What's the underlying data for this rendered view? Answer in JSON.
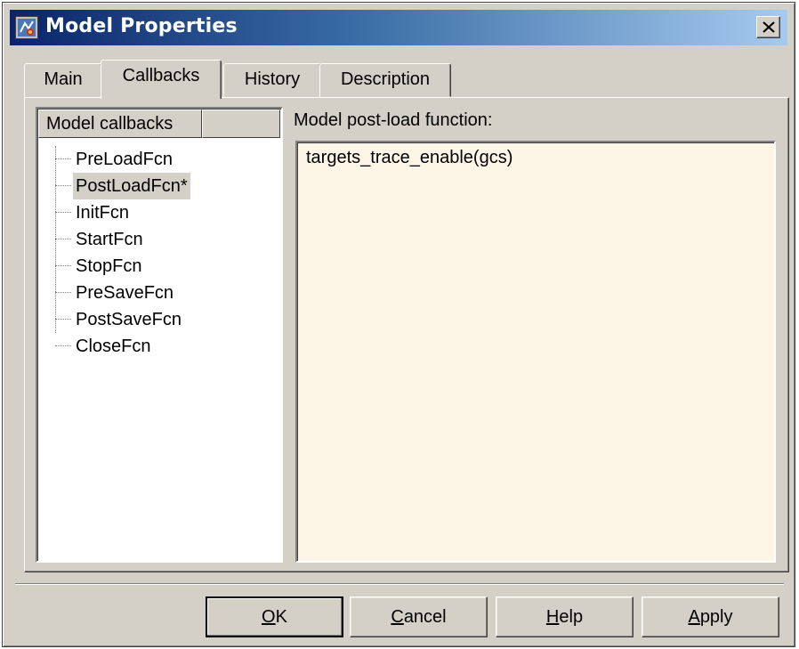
{
  "window": {
    "title": "Model Properties",
    "icon": "simulink-model-icon",
    "close_icon": "close-icon"
  },
  "tabs": [
    {
      "label": "Main",
      "active": false
    },
    {
      "label": "Callbacks",
      "active": true
    },
    {
      "label": "History",
      "active": false
    },
    {
      "label": "Description",
      "active": false
    }
  ],
  "callbacks": {
    "header": "Model callbacks",
    "items": [
      {
        "label": "PreLoadFcn",
        "selected": false
      },
      {
        "label": "PostLoadFcn*",
        "selected": true
      },
      {
        "label": "InitFcn",
        "selected": false
      },
      {
        "label": "StartFcn",
        "selected": false
      },
      {
        "label": "StopFcn",
        "selected": false
      },
      {
        "label": "PreSaveFcn",
        "selected": false
      },
      {
        "label": "PostSaveFcn",
        "selected": false
      },
      {
        "label": "CloseFcn",
        "selected": false
      }
    ],
    "function_label": "Model post-load function:",
    "function_code": "targets_trace_enable(gcs)"
  },
  "buttons": {
    "ok": {
      "mnemonic": "O",
      "rest": "K"
    },
    "cancel": {
      "mnemonic": "C",
      "rest": "ancel"
    },
    "help": {
      "mnemonic": "H",
      "rest": "elp"
    },
    "apply": {
      "mnemonic": "A",
      "rest": "pply"
    }
  },
  "colors": {
    "dialog_face": "#d4d0c8",
    "title_active_start": "#0a246a",
    "title_active_end": "#a6caf0",
    "editor_background": "#fdf5e6"
  }
}
